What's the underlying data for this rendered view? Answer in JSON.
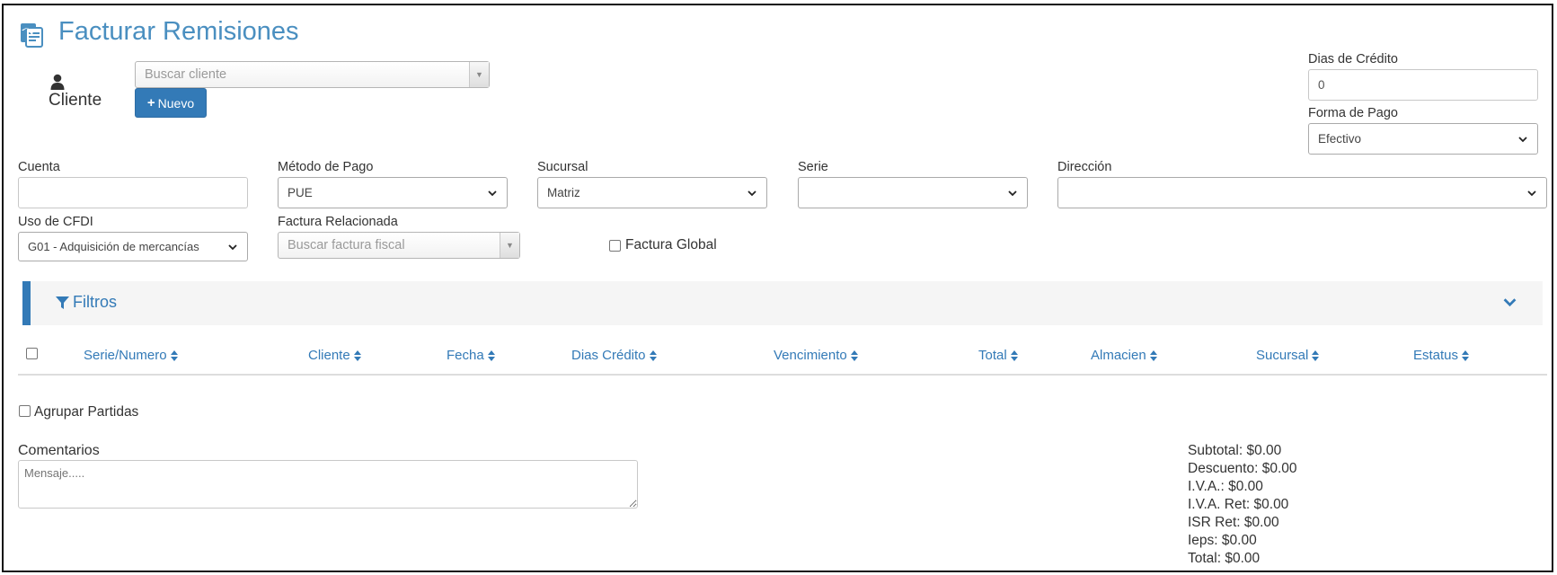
{
  "page": {
    "title": "Facturar Remisiones"
  },
  "cliente": {
    "label": "Cliente",
    "search_placeholder": "Buscar cliente",
    "new_button_label": "Nuevo"
  },
  "credito": {
    "label": "Dias de Crédito",
    "value": "0"
  },
  "forma_pago": {
    "label": "Forma de Pago",
    "value": "Efectivo"
  },
  "cuenta": {
    "label": "Cuenta",
    "value": ""
  },
  "metodo_pago": {
    "label": "Método de Pago",
    "value": "PUE"
  },
  "sucursal": {
    "label": "Sucursal",
    "value": "Matriz"
  },
  "serie": {
    "label": "Serie",
    "value": ""
  },
  "direccion": {
    "label": "Dirección",
    "value": ""
  },
  "uso_cfdi": {
    "label": "Uso de CFDI",
    "value": "G01 - Adquisición de mercancías"
  },
  "factura_relacionada": {
    "label": "Factura Relacionada",
    "placeholder": "Buscar factura fiscal"
  },
  "factura_global": {
    "label": "Factura Global"
  },
  "filtros": {
    "label": "Filtros"
  },
  "table": {
    "columns": [
      "Serie/Numero",
      "Cliente",
      "Fecha",
      "Dias Crédito",
      "Vencimiento",
      "Total",
      "Almacien",
      "Sucursal",
      "Estatus"
    ]
  },
  "agrupar": {
    "label": "Agrupar Partidas"
  },
  "comentarios": {
    "label": "Comentarios",
    "placeholder": "Mensaje....."
  },
  "totals": {
    "subtotal": "Subtotal: $0.00",
    "descuento": "Descuento: $0.00",
    "iva": "I.V.A.: $0.00",
    "iva_ret": "I.V.A. Ret: $0.00",
    "isr_ret": "ISR Ret: $0.00",
    "ieps": "Ieps: $0.00",
    "total": "Total: $0.00"
  },
  "colors": {
    "accent": "#337ab7",
    "title": "#4a8fc0",
    "panel": "#f5f5f5"
  },
  "icons": [
    "invoice-icon",
    "user-icon",
    "plus-icon",
    "filter-icon",
    "chevron-down-icon",
    "sort-icon"
  ]
}
